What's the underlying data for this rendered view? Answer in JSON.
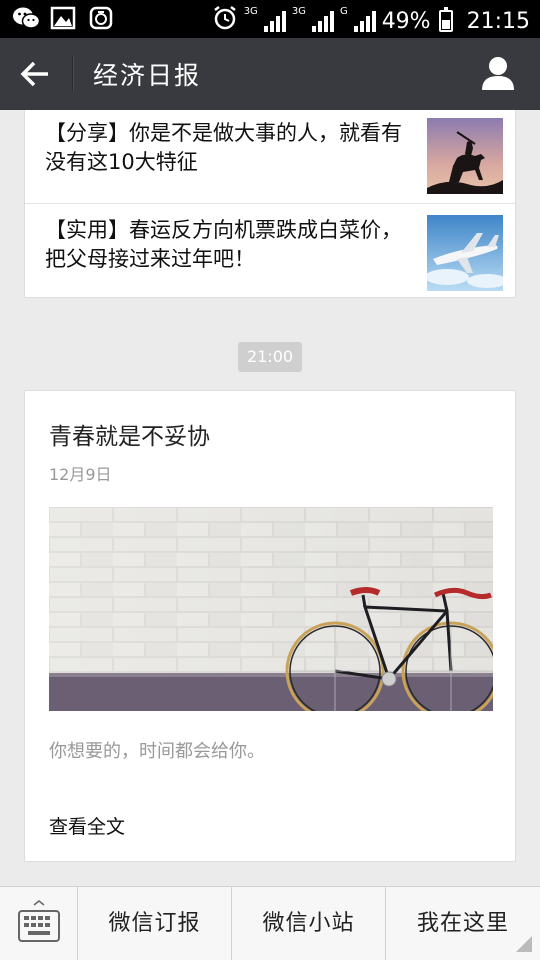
{
  "status_bar": {
    "net1": "3G",
    "net2": "3G",
    "net3": "G",
    "battery": "49%",
    "time": "21:15",
    "icons": [
      "wechat-icon",
      "image-icon",
      "app-icon",
      "alarm-icon"
    ]
  },
  "header": {
    "title": "经济日报",
    "back_icon": "arrow-left-icon",
    "profile_icon": "person-icon"
  },
  "articles": [
    {
      "title": "【分享】你是不是做大事的人，就看有没有这10大特征",
      "thumb": "horse-rider-silhouette"
    },
    {
      "title": "【实用】春运反方向机票跌成白菜价，把父母接过来过年吧！",
      "thumb": "airplane-sky"
    }
  ],
  "timestamp": "21:00",
  "card": {
    "title": "青春就是不妥协",
    "date": "12月9日",
    "image": "bicycle-against-brick-wall",
    "description": "你想要的，时间都会给你。",
    "read_more": "查看全文"
  },
  "bottom_menu": {
    "keyboard_icon": "keyboard-icon",
    "items": [
      "微信订报",
      "微信小站",
      "我在这里"
    ]
  },
  "colors": {
    "title_bar": "#393a3f",
    "background": "#ebebeb",
    "status_bar": "#000000"
  }
}
